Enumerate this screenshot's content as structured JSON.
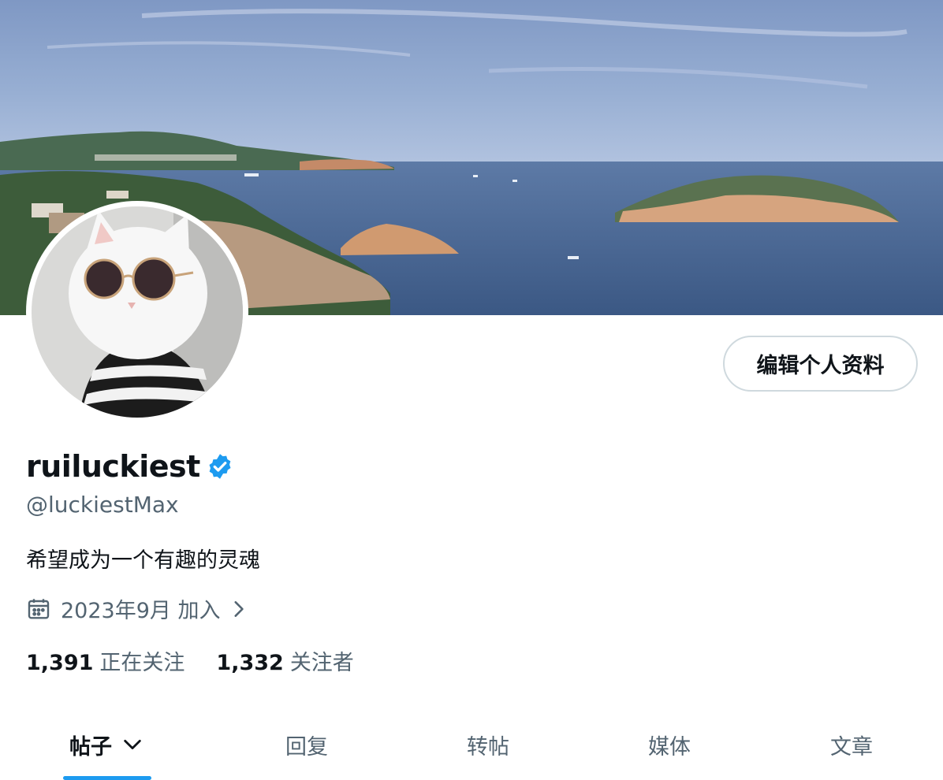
{
  "profile": {
    "display_name": "ruiluckiest",
    "handle": "@luckiestMax",
    "bio": "希望成为一个有趣的灵魂",
    "joined": "2023年9月 加入",
    "verified": true,
    "verified_color": "#1d9bf0"
  },
  "actions": {
    "edit_profile": "编辑个人资料"
  },
  "stats": {
    "following_count": "1,391",
    "following_label": "正在关注",
    "followers_count": "1,332",
    "followers_label": "关注者"
  },
  "tabs": [
    {
      "label": "帖子",
      "active": true
    },
    {
      "label": "回复",
      "active": false
    },
    {
      "label": "转帖",
      "active": false
    },
    {
      "label": "媒体",
      "active": false
    },
    {
      "label": "文章",
      "active": false
    }
  ],
  "icons": {
    "verified": "verified-badge-icon",
    "calendar": "calendar-icon",
    "joined_chevron": "chevron-right-icon",
    "tab_chevron": "chevron-down-icon"
  },
  "colors": {
    "accent": "#1d9bf0",
    "text_primary": "#0f1419",
    "text_secondary": "#536471",
    "border": "#cfd9de"
  }
}
